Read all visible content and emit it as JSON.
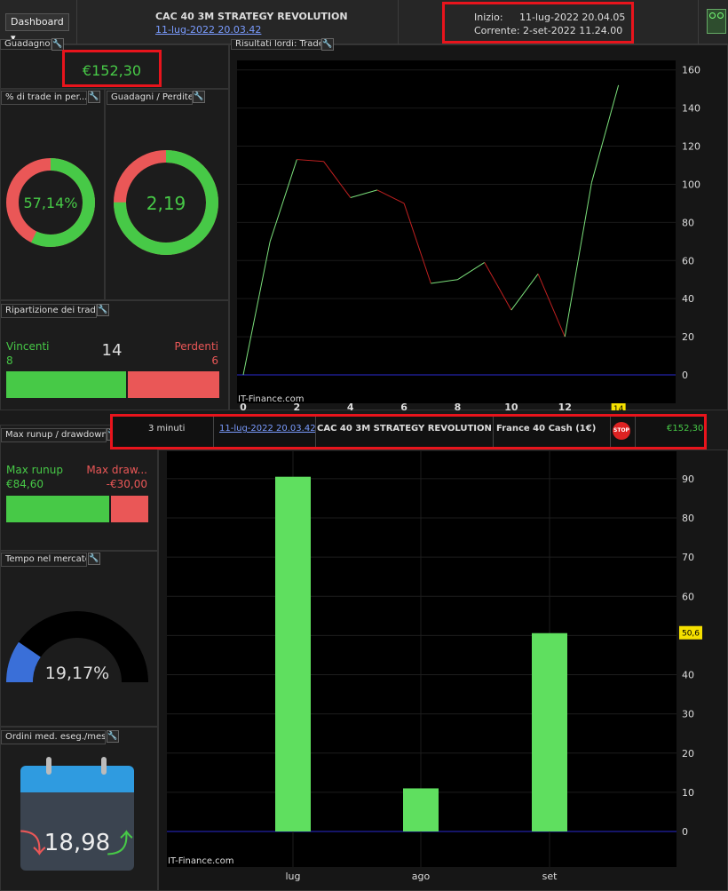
{
  "header": {
    "dashboard_label": "Dashboard ▾",
    "strategy_title": "CAC 40 3M STRATEGY REVOLUTION",
    "strategy_date": "11-lug-2022 20.03.42",
    "start_label": "Inizio:",
    "start_value": "11-lug-2022 20.04.05",
    "current_label": "Corrente:",
    "current_value": "2-set-2022 11.24.00"
  },
  "gain_panel": {
    "title": "Guadagno",
    "value": "€152,30"
  },
  "pct_panel": {
    "title": "% di trade in per...",
    "value": "57,14%",
    "fraction": 0.5714
  },
  "gl_panel": {
    "title": "Guadagni / Perdite",
    "value": "2,19",
    "fraction": 0.75
  },
  "breakdown": {
    "title": "Ripartizione dei trade",
    "winners_label": "Vincenti",
    "winners": "8",
    "total": "14",
    "losers_label": "Perdenti",
    "losers": "6",
    "winners_fraction": 0.5714
  },
  "runup": {
    "title": "Max runup / drawdown",
    "runup_label": "Max runup",
    "runup_value": "€84,60",
    "drawdown_label": "Max draw...",
    "drawdown_value": "-€30,00",
    "runup_fraction": 0.738
  },
  "time_market": {
    "title": "Tempo nel mercato",
    "value": "19,17%",
    "fraction": 0.1917
  },
  "orders": {
    "title": "Ordini med. eseg./mese",
    "value": "18,98"
  },
  "results_chart_title": "Risultati lordi: Trade",
  "watermark": "IT-Finance.com",
  "status_bar": {
    "timeframe": "3 minuti",
    "date": "11-lug-2022 20.03.42",
    "strategy": "CAC 40 3M STRATEGY REVOLUTION",
    "instrument": "France 40 Cash (1€)",
    "stop_label": "STOP",
    "value": "€152,30"
  },
  "colors": {
    "green": "#47c947",
    "red": "#ea5757",
    "blue": "#3a6fd8",
    "highlight": "#e8141c"
  },
  "chart_data": [
    {
      "type": "line",
      "x": [
        0,
        1,
        2,
        3,
        4,
        5,
        6,
        7,
        8,
        9,
        10,
        11,
        12,
        13,
        14
      ],
      "y": [
        0,
        70,
        113,
        112,
        93,
        97,
        90,
        48,
        50,
        59,
        34,
        53,
        20,
        101,
        152
      ],
      "xticks": [
        "0",
        "2",
        "4",
        "6",
        "8",
        "10",
        "12",
        "14"
      ],
      "yticks": [
        "0",
        "20",
        "40",
        "60",
        "80",
        "100",
        "120",
        "140",
        "160"
      ],
      "xlim": [
        0,
        16
      ],
      "ylim": [
        0,
        165
      ],
      "current_marker": "14"
    },
    {
      "type": "bar",
      "categories": [
        "lug",
        "ago",
        "set"
      ],
      "values": [
        90.5,
        11,
        50.6
      ],
      "yticks": [
        "0",
        "10",
        "20",
        "30",
        "40",
        "50",
        "60",
        "70",
        "80",
        "90"
      ],
      "ylim": [
        0,
        97
      ],
      "current_marker": "50,6"
    }
  ]
}
